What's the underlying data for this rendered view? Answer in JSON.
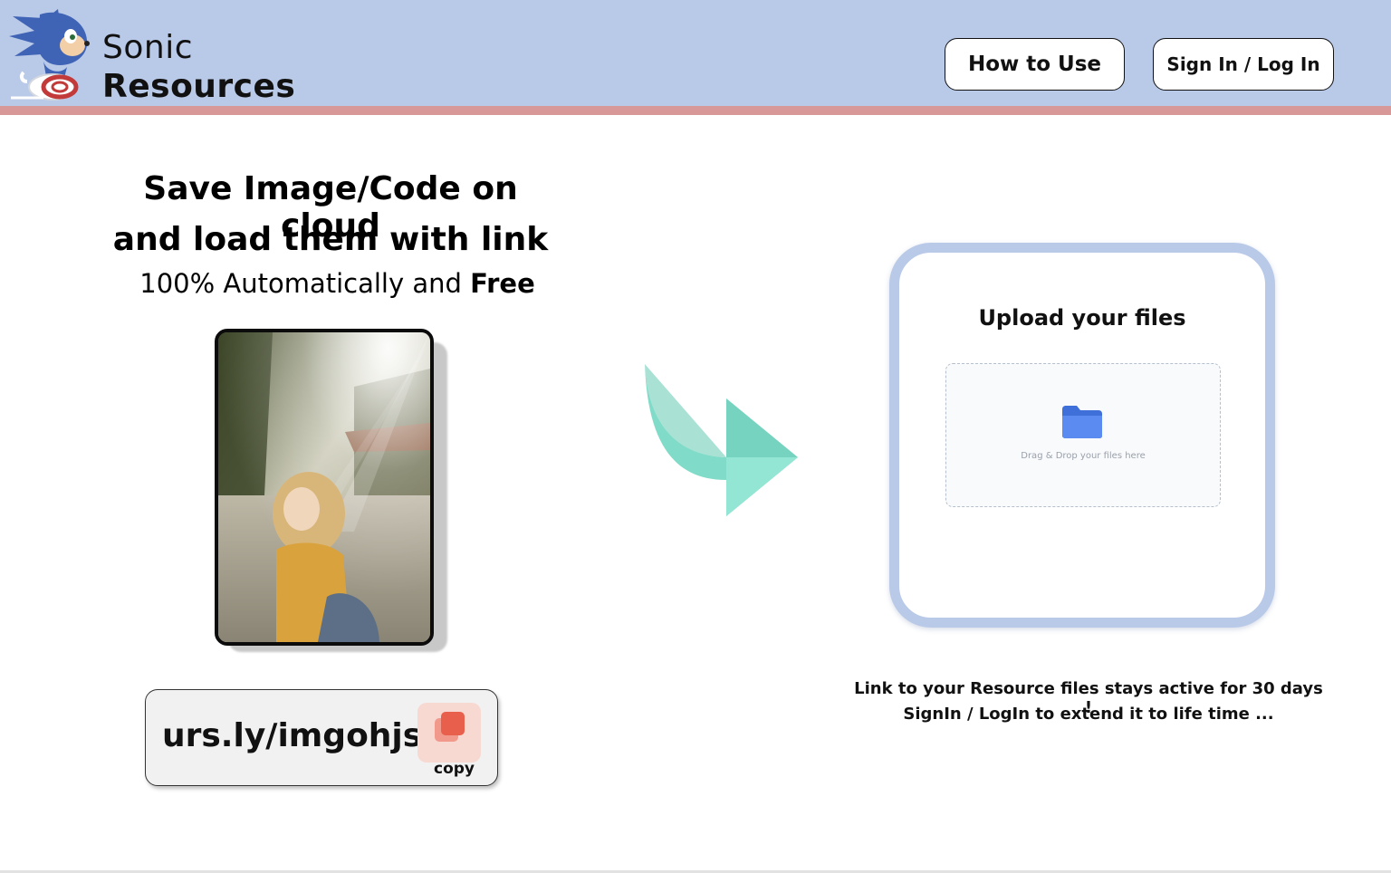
{
  "header": {
    "brand_line1": "Sonic",
    "brand_line2": "Resources",
    "logo_icon": "sonic-logo-icon",
    "buttons": {
      "how_to_use": "How to Use",
      "sign_in": "Sign In / Log In"
    },
    "colors": {
      "background": "#b9c9e8",
      "accent_stripe": "#d89898"
    }
  },
  "hero": {
    "headline_line1": "Save Image/Code on cloud",
    "headline_line2": "and load them with link",
    "subline_prefix": "100% Automatically and ",
    "subline_emphasis": "Free"
  },
  "preview": {
    "image_icon": "photo-preview",
    "link": "urs.ly/imgohjs",
    "copy_label": "copy",
    "copy_icon": "copy-icon",
    "copy_color": "#e8604c"
  },
  "arrow": {
    "icon": "curved-arrow-right-icon",
    "color": "#80dcc8"
  },
  "upload": {
    "title": "Upload your files",
    "drop_text": "Drag & Drop your files here",
    "folder_icon": "folder-icon",
    "folder_color": "#4b7be3",
    "card_border_color": "#b9c9e8"
  },
  "notes": {
    "line1": "Link to your Resource files stays active for 30 days !",
    "line2": "SignIn / LogIn to extend it to life time ..."
  }
}
